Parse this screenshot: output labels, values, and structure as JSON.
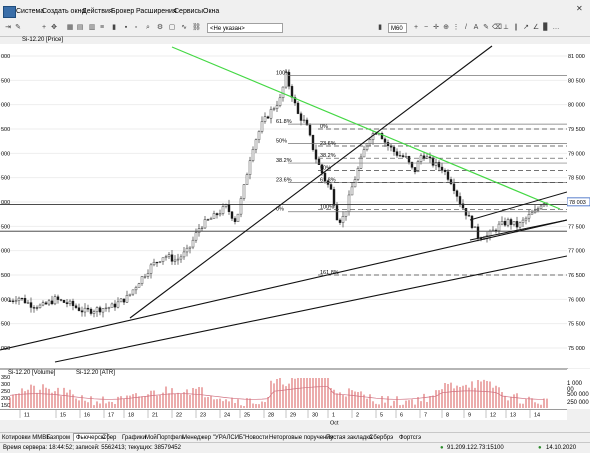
{
  "menu": {
    "items": [
      "Система",
      "Создать окно",
      "Действия",
      "Брокер",
      "Расширения",
      "Сервисы",
      "Окна"
    ]
  },
  "toolbar": {
    "dropdown_value": "<Не указан>",
    "timeframe": "M60"
  },
  "chart": {
    "title": "Si-12.20 [Price]",
    "price_ticks": [
      "81 000",
      "80 500",
      "80 000",
      "79 500",
      "79 000",
      "78 500",
      "78 000",
      "77 500",
      "77 000",
      "76 500",
      "76 000",
      "75 500",
      "75 000"
    ],
    "current_price": "78 003",
    "left_ticks": [
      "000",
      "500",
      "000",
      "500",
      "000",
      "500",
      "000",
      "500",
      "000",
      "500",
      "000",
      "500",
      "000"
    ],
    "fib_labels": {
      "upper_100": "100%",
      "upper_618": "61.8%",
      "upper_50": "50%",
      "upper_382": "38.2%",
      "upper_236": "23.6%",
      "upper_0": "0%",
      "lower_0": "0%",
      "lower_236": "23.6%",
      "lower_382": "38.2%",
      "lower_50": "50%",
      "lower_618": "61.8%",
      "lower_100": "100%",
      "lower_1618": "161.8%"
    },
    "colors": {
      "trend_green": "#44d844",
      "line_black": "#111111",
      "candle": "#1a1a1a",
      "volume_red": "#d03030",
      "atr_pink": "#d07080"
    }
  },
  "sub_panel": {
    "legend_volume": "Si-12.20 [Volume]",
    "legend_atr": "Si-12.20 [ATR]",
    "left_ticks": [
      "350",
      "300",
      "250",
      "200",
      "150"
    ],
    "right_ticks": [
      "1 000 00",
      "500 000",
      "250 000"
    ]
  },
  "date_axis": {
    "labels": [
      "11",
      "15",
      "16",
      "17",
      "18",
      "21",
      "22",
      "23",
      "24",
      "25",
      "28",
      "29",
      "30",
      "1",
      "2",
      "5",
      "6",
      "7",
      "8",
      "9",
      "12",
      "13",
      "14"
    ],
    "month_label": "Oct"
  },
  "tabs": {
    "items": [
      "Котировки ММВБ",
      "Газпром",
      "Фьючерсы",
      "Сбер",
      "Графики",
      "МойПортфель",
      "Менеджер \"УРАЛСИБ\"",
      "Новости",
      "Неторговые поручения",
      "Пустая закладка",
      "Сбербрэ",
      "Фортсгэ"
    ],
    "active": "Фьючерсы"
  },
  "status": {
    "left": "Время сервера: 18:44:52; записей: 5562413; текущих: 38579452",
    "connection": "91.209.122.73:15100",
    "date": "14.10.2020"
  }
}
